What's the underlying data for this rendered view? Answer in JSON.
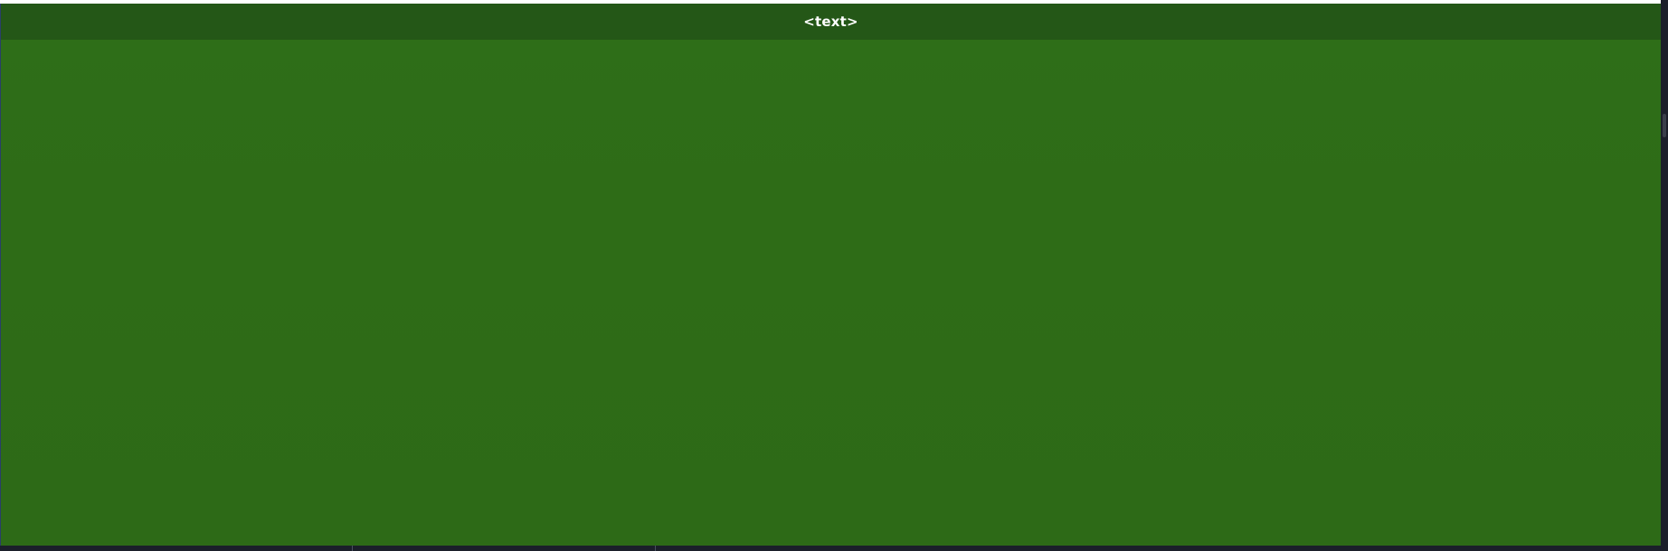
{
  "window": {
    "title": "<text>"
  },
  "colors": {
    "titlebar": "#245717",
    "content": "#2e6c17",
    "background": "#1b1f2a"
  }
}
